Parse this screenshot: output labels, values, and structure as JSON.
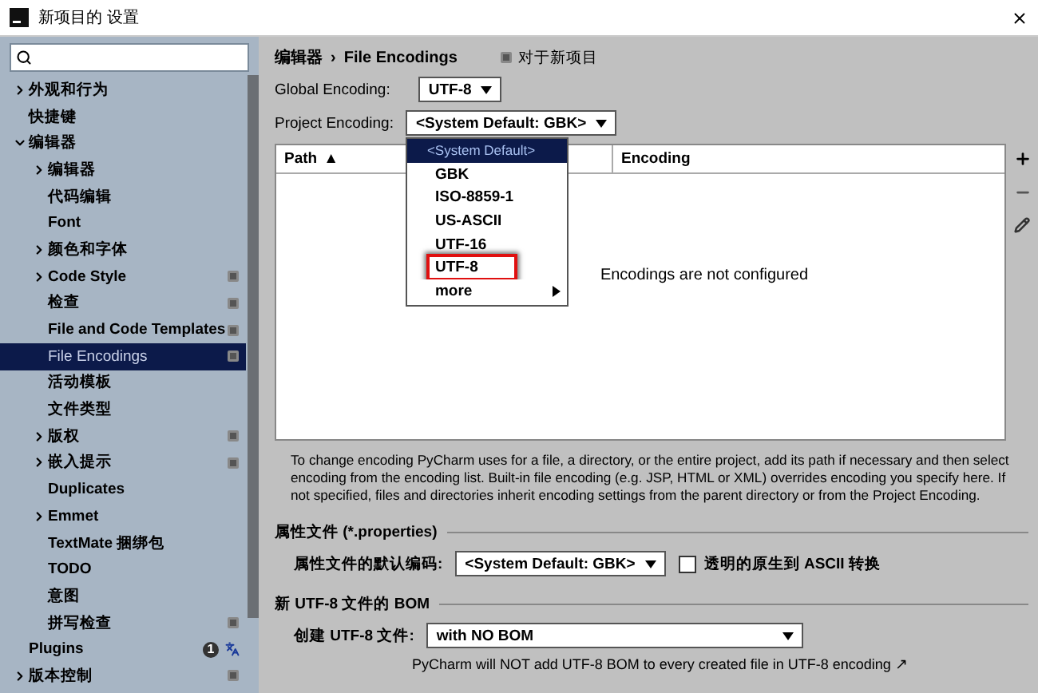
{
  "window": {
    "title": "新项目的 设置"
  },
  "sidebar": {
    "items": [
      {
        "label": "外观和行为",
        "expandable": true,
        "expanded": false,
        "selected": false,
        "scoped": false
      },
      {
        "label": "快捷键",
        "expandable": false,
        "selected": false,
        "scoped": false
      },
      {
        "label": "编辑器",
        "expandable": true,
        "expanded": true,
        "selected": false,
        "scoped": false,
        "children": [
          {
            "label": "编辑器",
            "expandable": true,
            "expanded": false,
            "selected": false,
            "scoped": false
          },
          {
            "label": "代码编辑",
            "expandable": false,
            "selected": false,
            "scoped": false
          },
          {
            "label": "Font",
            "expandable": false,
            "selected": false,
            "scoped": false
          },
          {
            "label": "颜色和字体",
            "expandable": true,
            "expanded": false,
            "selected": false,
            "scoped": false
          },
          {
            "label": "Code Style",
            "expandable": true,
            "expanded": false,
            "selected": false,
            "scoped": true
          },
          {
            "label": "检查",
            "expandable": false,
            "selected": false,
            "scoped": true
          },
          {
            "label": "File and Code Templates",
            "expandable": false,
            "selected": false,
            "scoped": true
          },
          {
            "label": "File Encodings",
            "expandable": false,
            "selected": true,
            "scoped": true
          },
          {
            "label": "活动模板",
            "expandable": false,
            "selected": false,
            "scoped": false
          },
          {
            "label": "文件类型",
            "expandable": false,
            "selected": false,
            "scoped": false
          },
          {
            "label": "版权",
            "expandable": true,
            "expanded": false,
            "selected": false,
            "scoped": true
          },
          {
            "label": "嵌入提示",
            "expandable": true,
            "expanded": false,
            "selected": false,
            "scoped": true
          },
          {
            "label": "Duplicates",
            "expandable": false,
            "selected": false,
            "scoped": false
          },
          {
            "label": "Emmet",
            "expandable": true,
            "expanded": false,
            "selected": false,
            "scoped": false
          },
          {
            "label": "TextMate 捆绑包",
            "expandable": false,
            "selected": false,
            "scoped": false
          },
          {
            "label": "TODO",
            "expandable": false,
            "selected": false,
            "scoped": false
          },
          {
            "label": "意图",
            "expandable": false,
            "selected": false,
            "scoped": false
          },
          {
            "label": "拼写检查",
            "expandable": false,
            "selected": false,
            "scoped": true
          }
        ]
      },
      {
        "label": "Plugins",
        "expandable": false,
        "selected": false,
        "scoped": false,
        "badge": "1",
        "translate": true
      },
      {
        "label": "版本控制",
        "expandable": true,
        "expanded": false,
        "selected": false,
        "scoped": true
      }
    ]
  },
  "breadcrumb": {
    "parent": "编辑器",
    "separator": "›",
    "current": "File Encodings",
    "scope": "对于新项目"
  },
  "global_encoding": {
    "label": "Global Encoding:",
    "value": "UTF-8"
  },
  "project_encoding": {
    "label": "Project Encoding:",
    "value": "<System Default: GBK>",
    "options": [
      {
        "label": "<System Default>",
        "selected": true,
        "highlighted": false,
        "submenu": false
      },
      {
        "label": "GBK",
        "selected": false,
        "highlighted": false,
        "submenu": false
      },
      {
        "label": "ISO-8859-1",
        "selected": false,
        "highlighted": false,
        "submenu": false
      },
      {
        "label": "US-ASCII",
        "selected": false,
        "highlighted": false,
        "submenu": false
      },
      {
        "label": "UTF-16",
        "selected": false,
        "highlighted": false,
        "submenu": false
      },
      {
        "label": "UTF-8",
        "selected": false,
        "highlighted": true,
        "submenu": false
      },
      {
        "label": "more",
        "selected": false,
        "highlighted": false,
        "submenu": true
      }
    ]
  },
  "table": {
    "columns": [
      {
        "label": "Path",
        "sort": "▲"
      },
      {
        "label": "Encoding"
      }
    ],
    "empty_text": "Encodings are not configured"
  },
  "description": "To change encoding PyCharm uses for a file, a directory, or the entire project, add its path if necessary and then select encoding from the encoding list. Built-in file encoding (e.g. JSP, HTML or XML) overrides encoding you specify here. If not specified, files and directories inherit encoding settings from the parent directory or from the Project Encoding.",
  "properties": {
    "title": "属性文件 (*.properties)",
    "label": "属性文件的默认编码:",
    "value": "<System Default: GBK>",
    "native_to_ascii": {
      "label": "透明的原生到 ASCII 转换",
      "checked": false
    }
  },
  "bom": {
    "title": "新 UTF-8 文件的 BOM",
    "label": "创建 UTF-8 文件:",
    "value": "with NO BOM",
    "note": "PyCharm will NOT add UTF-8 BOM to every created file in UTF-8 encoding",
    "note_link": "↗"
  }
}
